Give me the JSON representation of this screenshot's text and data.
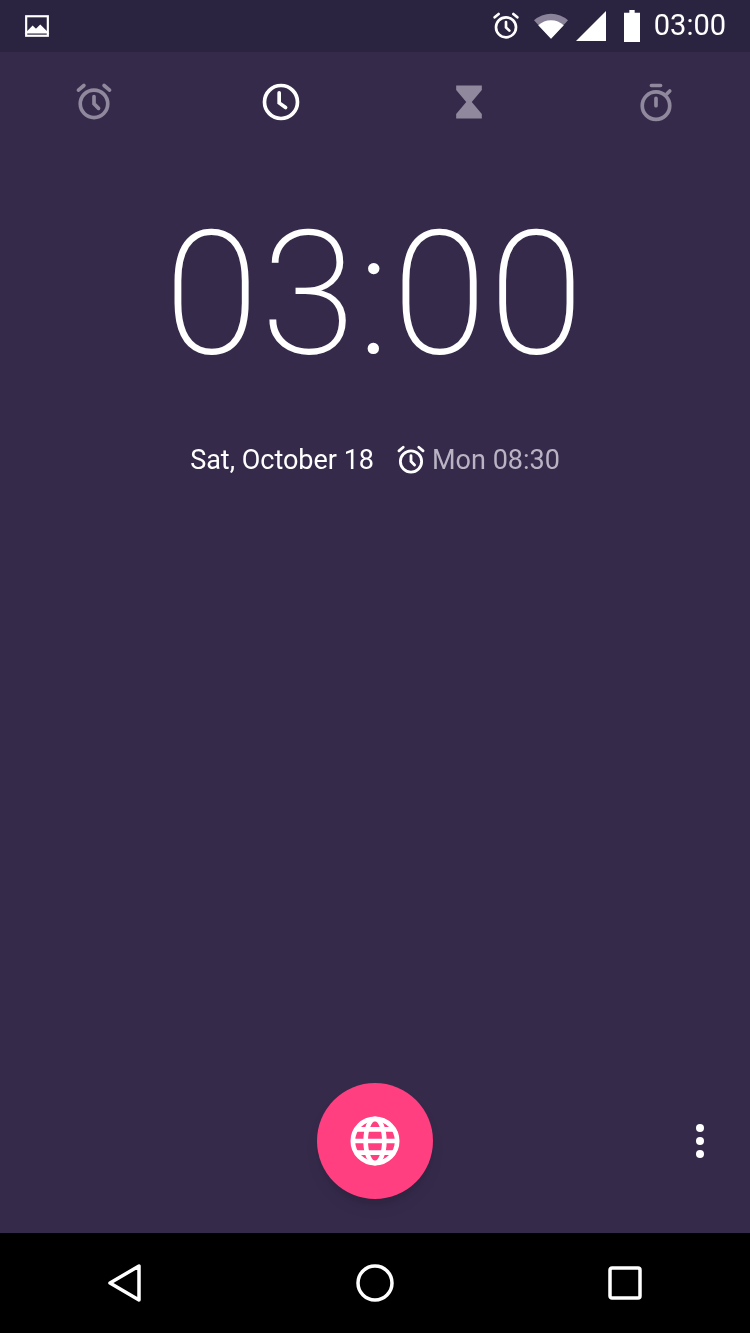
{
  "status_bar": {
    "time": "03:00"
  },
  "tabs": [
    {
      "kind": "alarm",
      "selected": false
    },
    {
      "kind": "clock",
      "selected": true
    },
    {
      "kind": "timer",
      "selected": false
    },
    {
      "kind": "stopwatch",
      "selected": false
    }
  ],
  "clock": {
    "time": "03:00",
    "date": "Sat, October 18",
    "next_alarm": "Mon 08:30"
  }
}
